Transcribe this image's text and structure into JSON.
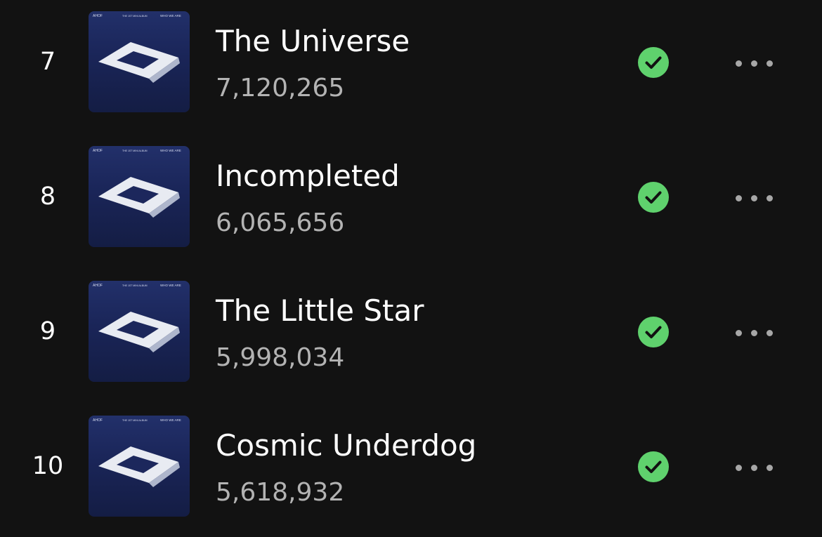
{
  "tracks": [
    {
      "rank": "7",
      "title": "The Universe",
      "plays": "7,120,265"
    },
    {
      "rank": "8",
      "title": "Incompleted",
      "plays": "6,065,656"
    },
    {
      "rank": "9",
      "title": "The Little Star",
      "plays": "5,998,034"
    },
    {
      "rank": "10",
      "title": "Cosmic Underdog",
      "plays": "5,618,932"
    }
  ],
  "cover_art": {
    "top_left_text": "AHOF",
    "top_center_text": "THE 1ST MINI ALBUM",
    "top_right_text": "WHO WE ARE"
  },
  "icons": {
    "downloaded": "check-circle-icon",
    "more": "more-horizontal-icon"
  },
  "colors": {
    "background": "#121212",
    "title": "#ffffff",
    "plays": "#b3b3b3",
    "downloaded_accent": "#1ed760",
    "more_dots": "#a7a7a7",
    "cover_bg": "#1a2558"
  }
}
